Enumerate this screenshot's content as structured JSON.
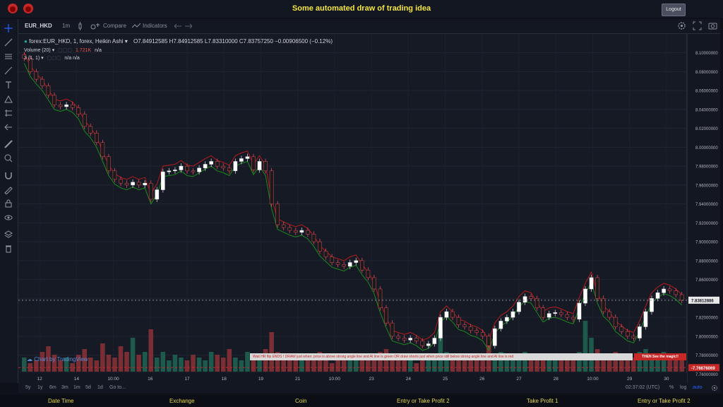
{
  "page": {
    "title": "Some automated draw of trading idea",
    "logout_label": "Logout"
  },
  "toolbar": {
    "symbol": "EUR_HKD",
    "interval": "1m",
    "compare_label": "Compare",
    "indicators_label": "Indicators"
  },
  "legend": {
    "main": "forex:EUR_HKD, 1, forex, Heikin Ashi",
    "ohlc": "O7.84912585  H7.84912585  L7.83310000  C7.83757250  −0.00906500 (−0.12%)",
    "volume_label": "Volume (20)",
    "volume_value": "1.721K",
    "volume_na": "n/a",
    "indicator_label": "3 (1, 1)",
    "indicator_values": "n/a  n/a"
  },
  "price_axis": {
    "ticks": [
      "8.10000000",
      "8.08000000",
      "8.06000000",
      "8.04000000",
      "8.02000000",
      "8.00000000",
      "7.98000000",
      "7.96000000",
      "7.94000000",
      "7.92000000",
      "7.90000000",
      "7.88000000",
      "7.86000000",
      "7.84000000",
      "7.82000000",
      "7.80000000",
      "7.78000000",
      "7.76000000"
    ],
    "current_price": "7.83812886",
    "red_price": "7.76676069"
  },
  "time_axis": [
    "12",
    "14",
    "10:00",
    "16",
    "17",
    "18",
    "19",
    "21",
    "10:00",
    "23",
    "24",
    "25",
    "26",
    "27",
    "28",
    "10:00",
    "29",
    "30"
  ],
  "banner": {
    "text": "Wait HR flip ENDS  !   DRAW just when:  price is above strong angle line and AI line is green   OR   draw shorts just when price still below strong angle line and AI line is red",
    "magic": "THEN See the magic!!"
  },
  "watermark": "Chart by TradingView",
  "ranges": [
    "5y",
    "1y",
    "6m",
    "3m",
    "1m",
    "5d",
    "1d"
  ],
  "goto_label": "Go to...",
  "clock": "02:37:02 (UTC)",
  "scale_options": [
    "%",
    "log",
    "auto"
  ],
  "tabs": [
    "Date Time",
    "Exchange",
    "Coin",
    "Entry or Take Profit 2",
    "Take Profit 1",
    "Entry or Take Profit 2"
  ],
  "colors": {
    "title": "#f4e542",
    "bull": "#26a69a",
    "bear": "#ef5350",
    "red_line": "#b71c1c",
    "green_line": "#1b8a1b",
    "tab_text": "#e5d845"
  },
  "chart_data": {
    "type": "candlestick",
    "title": "forex:EUR_HKD, 1, forex, Heikin Ashi",
    "ylim": [
      7.755,
      8.105
    ],
    "close": [
      8.094,
      8.08,
      8.072,
      8.065,
      8.055,
      8.045,
      8.043,
      8.045,
      8.042,
      8.035,
      8.022,
      8.015,
      8.005,
      7.99,
      7.975,
      7.966,
      7.962,
      7.96,
      7.963,
      7.96,
      7.962,
      7.945,
      7.955,
      7.974,
      7.975,
      7.976,
      7.98,
      7.975,
      7.974,
      7.978,
      7.982,
      7.985,
      7.98,
      7.978,
      7.975,
      7.985,
      7.988,
      7.99,
      7.976,
      7.985,
      7.975,
      7.94,
      7.918,
      7.915,
      7.912,
      7.91,
      7.912,
      7.908,
      7.9,
      7.89,
      7.884,
      7.878,
      7.876,
      7.874,
      7.878,
      7.88,
      7.87,
      7.862,
      7.85,
      7.83,
      7.814,
      7.8,
      7.798,
      7.796,
      7.798,
      7.795,
      7.79,
      7.792,
      7.798,
      7.82,
      7.826,
      7.82,
      7.812,
      7.81,
      7.806,
      7.804,
      7.8,
      7.79,
      7.808,
      7.816,
      7.82,
      7.826,
      7.836,
      7.842,
      7.84,
      7.83,
      7.82,
      7.824,
      7.825,
      7.823,
      7.82,
      7.818,
      7.835,
      7.85,
      7.862,
      7.84,
      7.826,
      7.82,
      7.81,
      7.805,
      7.8,
      7.798,
      7.81,
      7.826,
      7.84,
      7.846,
      7.85,
      7.848,
      7.844,
      7.838
    ],
    "volume": [
      5,
      3,
      4,
      7,
      9,
      6,
      4,
      5,
      3,
      6,
      8,
      5,
      4,
      10,
      6,
      5,
      9,
      7,
      12,
      6,
      7,
      15,
      5,
      7,
      4,
      6,
      5,
      4,
      6,
      5,
      4,
      7,
      6,
      5,
      8,
      5,
      4,
      7,
      6,
      5,
      8,
      14,
      7,
      5,
      6,
      4,
      5,
      6,
      4,
      7,
      5,
      3,
      6,
      5,
      4,
      6,
      5,
      4,
      6,
      7,
      8,
      5,
      6,
      4,
      5,
      3,
      4,
      6,
      5,
      15,
      7,
      5,
      6,
      4,
      5,
      6,
      4,
      12,
      5,
      7,
      6,
      5,
      6,
      7,
      5,
      4,
      6,
      5,
      4,
      5,
      6,
      4,
      7,
      18,
      12,
      8,
      6,
      5,
      7,
      4,
      6,
      5,
      7,
      8,
      6,
      5,
      7,
      5,
      6,
      5
    ]
  }
}
